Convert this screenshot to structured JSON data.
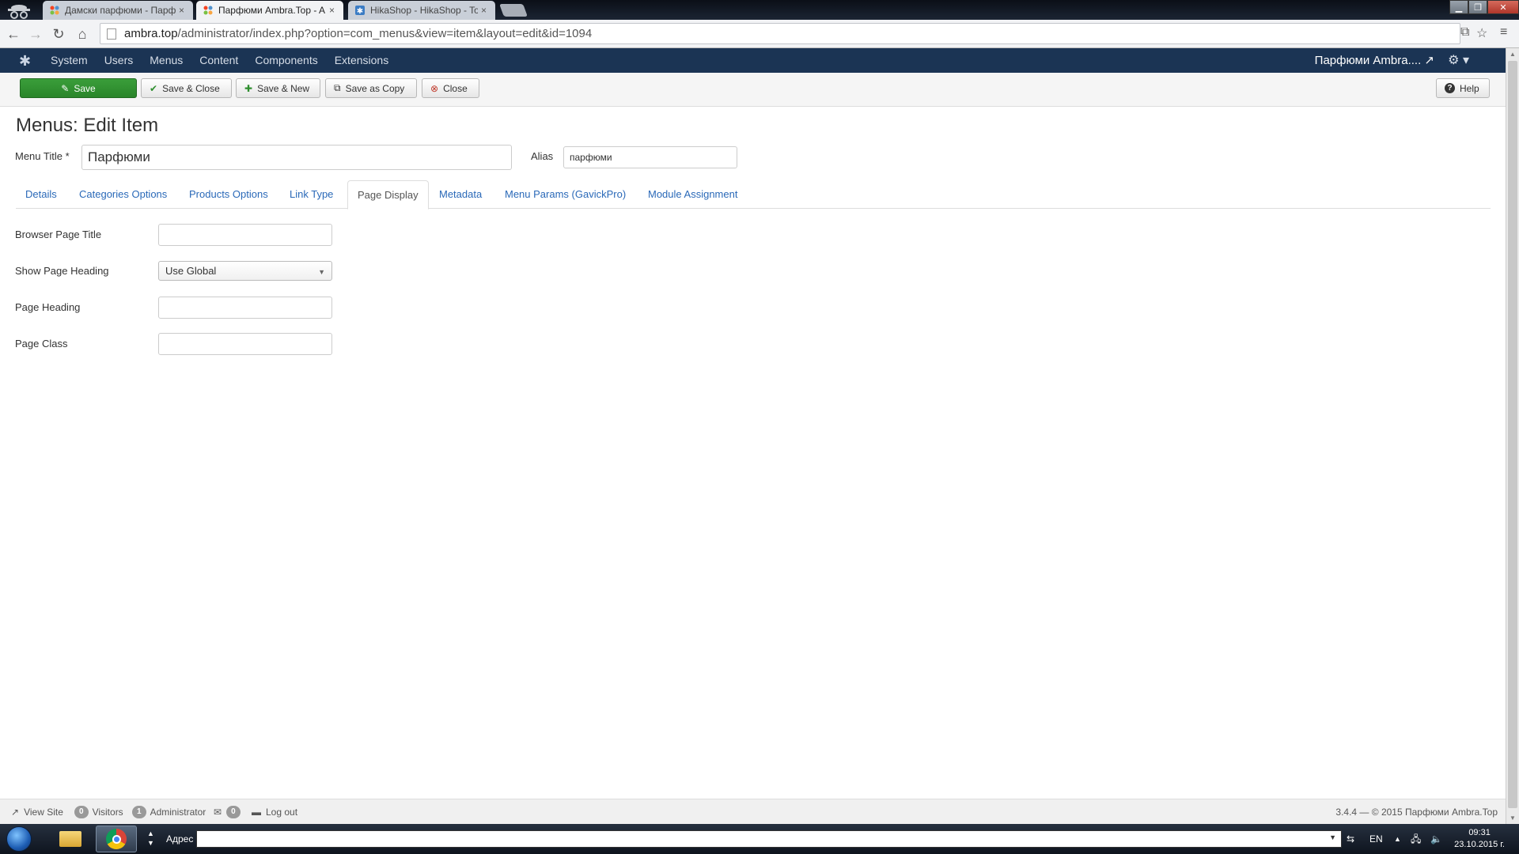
{
  "browser": {
    "tabs": [
      {
        "label": "Дамски парфюми - Парф",
        "close": "×"
      },
      {
        "label": "Парфюми Ambra.Top - A",
        "close": "×"
      },
      {
        "label": "HikaShop - HikaShop - To",
        "close": "×"
      }
    ],
    "url": {
      "domain": "ambra.top",
      "path": "/administrator/index.php?option=com_menus&view=item&layout=edit&id=1094"
    },
    "window_buttons": {
      "minimize": "▁",
      "maximize": "❐",
      "close": "✕"
    }
  },
  "joomla_nav": {
    "items": [
      "System",
      "Users",
      "Menus",
      "Content",
      "Components",
      "Extensions"
    ],
    "site_title": "Парфюми Ambra.... ↗",
    "logo": "joomla-logo",
    "settings_icon": "gear-icon"
  },
  "toolbar": {
    "save": {
      "label": "Save",
      "icon": "✎"
    },
    "save_close": {
      "label": "Save & Close",
      "icon": "✔"
    },
    "save_new": {
      "label": "Save & New",
      "icon": "✚"
    },
    "save_copy": {
      "label": "Save as Copy",
      "icon": "⧉"
    },
    "close": {
      "label": "Close",
      "icon": "⊗"
    },
    "help": {
      "label": "Help",
      "icon": "?"
    }
  },
  "page": {
    "title": "Menus: Edit Item",
    "menu_title_label": "Menu Title *",
    "menu_title_value": "Парфюми",
    "alias_label": "Alias",
    "alias_value": "парфюми"
  },
  "tabs": [
    {
      "label": "Details"
    },
    {
      "label": "Categories Options"
    },
    {
      "label": "Products Options"
    },
    {
      "label": "Link Type"
    },
    {
      "label": "Page Display",
      "active": true
    },
    {
      "label": "Metadata"
    },
    {
      "label": "Menu Params (GavickPro)"
    },
    {
      "label": "Module Assignment"
    }
  ],
  "form": {
    "browser_page_title": {
      "label": "Browser Page Title",
      "value": ""
    },
    "show_page_heading": {
      "label": "Show Page Heading",
      "value": "Use Global"
    },
    "page_heading": {
      "label": "Page Heading",
      "value": ""
    },
    "page_class": {
      "label": "Page Class",
      "value": ""
    }
  },
  "statusbar": {
    "view_site": "View Site",
    "visitors_count": "0",
    "visitors_label": "Visitors",
    "admin_count": "1",
    "admin_label": "Administrator",
    "messages_count": "0",
    "logout": "Log out",
    "version": "3.4.4 — © 2015 Парфюми Ambra.Top"
  },
  "taskbar": {
    "address_label": "Адрес",
    "language": "EN",
    "time": "09:31",
    "date": "23.10.2015 г."
  },
  "colors": {
    "joomla_nav": "#1b3454",
    "save_button": "#2f8f2f",
    "link": "#2a69b8"
  }
}
